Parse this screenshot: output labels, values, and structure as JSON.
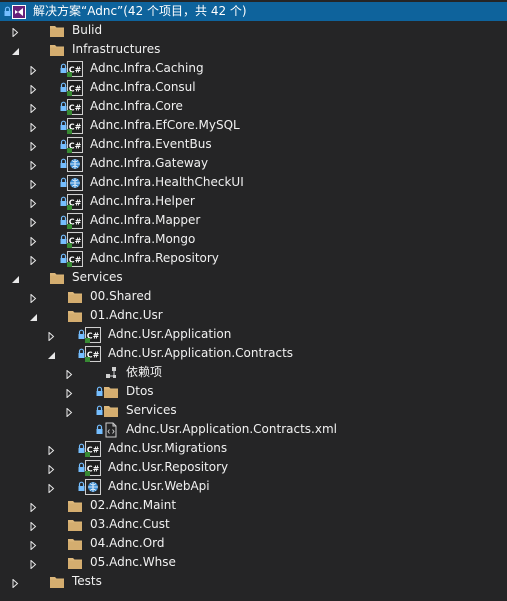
{
  "solution": {
    "label": "解决方案“Adnc”(42 个项目，共 42 个)"
  },
  "items": [
    {
      "label": "Bulid",
      "icon": "folder-icon",
      "state": "collapsed"
    },
    {
      "label": "Infrastructures",
      "icon": "folder-icon",
      "state": "expanded"
    },
    {
      "label": "Adnc.Infra.Caching",
      "icon": "csharp-project-icon",
      "state": "collapsed",
      "locked": true
    },
    {
      "label": "Adnc.Infra.Consul",
      "icon": "csharp-project-icon",
      "state": "collapsed",
      "locked": true
    },
    {
      "label": "Adnc.Infra.Core",
      "icon": "csharp-project-icon",
      "state": "collapsed",
      "locked": true
    },
    {
      "label": "Adnc.Infra.EfCore.MySQL",
      "icon": "csharp-project-icon",
      "state": "collapsed",
      "locked": true
    },
    {
      "label": "Adnc.Infra.EventBus",
      "icon": "csharp-project-icon",
      "state": "collapsed",
      "locked": true
    },
    {
      "label": "Adnc.Infra.Gateway",
      "icon": "web-project-icon",
      "state": "collapsed",
      "locked": true
    },
    {
      "label": "Adnc.Infra.HealthCheckUI",
      "icon": "web-project-icon",
      "state": "collapsed",
      "locked": true
    },
    {
      "label": "Adnc.Infra.Helper",
      "icon": "csharp-project-icon",
      "state": "collapsed",
      "locked": true
    },
    {
      "label": "Adnc.Infra.Mapper",
      "icon": "csharp-project-icon",
      "state": "collapsed",
      "locked": true
    },
    {
      "label": "Adnc.Infra.Mongo",
      "icon": "csharp-project-icon",
      "state": "collapsed",
      "locked": true
    },
    {
      "label": "Adnc.Infra.Repository",
      "icon": "csharp-project-icon",
      "state": "collapsed",
      "locked": true
    },
    {
      "label": "Services",
      "icon": "folder-icon",
      "state": "expanded"
    },
    {
      "label": "00.Shared",
      "icon": "folder-icon",
      "state": "collapsed"
    },
    {
      "label": "01.Adnc.Usr",
      "icon": "folder-icon",
      "state": "expanded"
    },
    {
      "label": "Adnc.Usr.Application",
      "icon": "csharp-project-icon",
      "state": "collapsed",
      "locked": true
    },
    {
      "label": "Adnc.Usr.Application.Contracts",
      "icon": "csharp-project-icon",
      "state": "expanded",
      "locked": true
    },
    {
      "label": "依赖项",
      "icon": "dependencies-icon",
      "state": "collapsed"
    },
    {
      "label": "Dtos",
      "icon": "folder-icon",
      "state": "collapsed",
      "locked": true
    },
    {
      "label": "Services",
      "icon": "folder-icon",
      "state": "collapsed",
      "locked": true
    },
    {
      "label": "Adnc.Usr.Application.Contracts.xml",
      "icon": "xml-file-icon",
      "state": "none",
      "locked": true
    },
    {
      "label": "Adnc.Usr.Migrations",
      "icon": "csharp-project-icon",
      "state": "collapsed",
      "locked": true
    },
    {
      "label": "Adnc.Usr.Repository",
      "icon": "csharp-project-icon",
      "state": "collapsed",
      "locked": true
    },
    {
      "label": "Adnc.Usr.WebApi",
      "icon": "web-project-icon",
      "state": "collapsed",
      "locked": true
    },
    {
      "label": "02.Adnc.Maint",
      "icon": "folder-icon",
      "state": "collapsed"
    },
    {
      "label": "03.Adnc.Cust",
      "icon": "folder-icon",
      "state": "collapsed"
    },
    {
      "label": "04.Adnc.Ord",
      "icon": "folder-icon",
      "state": "collapsed"
    },
    {
      "label": "05.Adnc.Whse",
      "icon": "folder-icon",
      "state": "collapsed"
    },
    {
      "label": "Tests",
      "icon": "folder-icon",
      "state": "collapsed"
    }
  ],
  "colors": {
    "background": "#252526",
    "selection": "#0e639c",
    "text": "#f1f1f1",
    "folder": "#dcb67a",
    "lock": "#75beff",
    "csharp_icon": "#388a34",
    "web_icon": "#3c8fd6",
    "vs_icon": "#68217a"
  }
}
